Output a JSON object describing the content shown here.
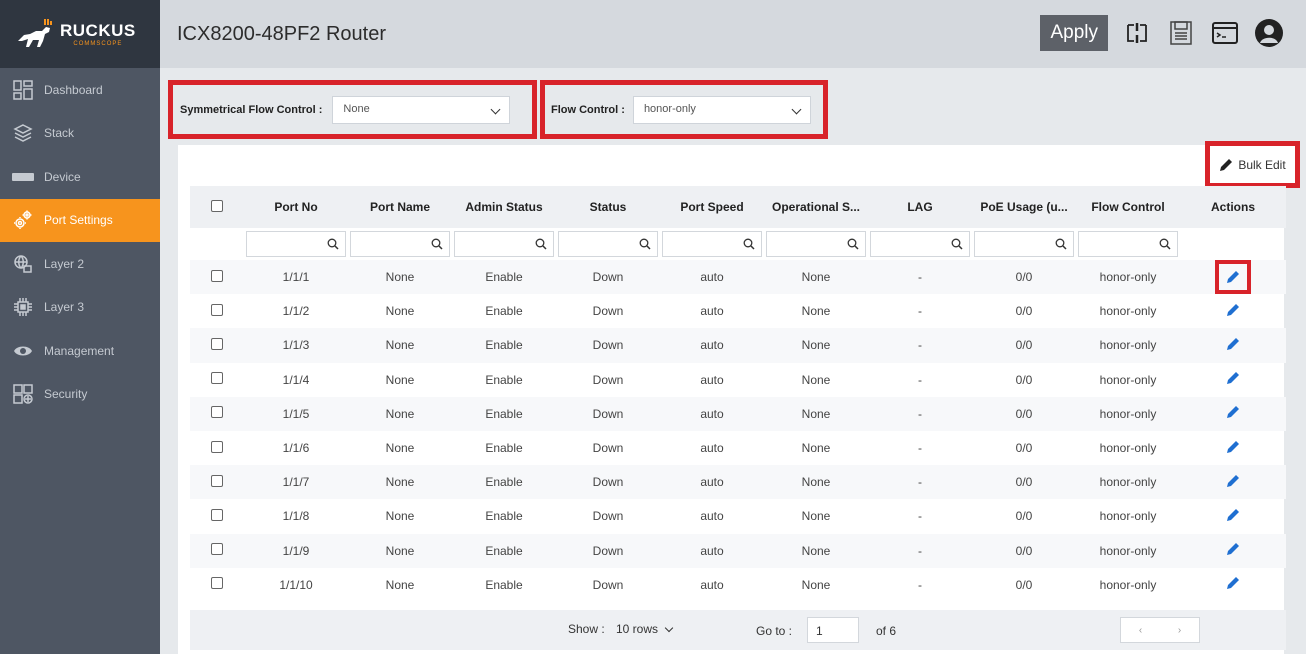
{
  "logo": {
    "brand": "RUCKUS",
    "sub": "COMMSCOPE"
  },
  "sidebar": {
    "items": [
      {
        "label": "Dashboard",
        "icon": "dashboard-icon"
      },
      {
        "label": "Stack",
        "icon": "stack-icon"
      },
      {
        "label": "Device",
        "icon": "device-icon"
      },
      {
        "label": "Port Settings",
        "icon": "gears-icon",
        "active": true
      },
      {
        "label": "Layer 2",
        "icon": "layer2-icon"
      },
      {
        "label": "Layer 3",
        "icon": "layer3-icon"
      },
      {
        "label": "Management",
        "icon": "eye-icon"
      },
      {
        "label": "Security",
        "icon": "security-icon"
      }
    ]
  },
  "header": {
    "title": "ICX8200-48PF2 Router",
    "apply_label": "Apply"
  },
  "filters": {
    "symmetrical_label": "Symmetrical Flow Control :",
    "symmetrical_value": "None",
    "flow_label": "Flow Control :",
    "flow_value": "honor-only"
  },
  "bulk_edit_label": "Bulk Edit",
  "table": {
    "columns": [
      "Port No",
      "Port Name",
      "Admin Status",
      "Status",
      "Port Speed",
      "Operational S...",
      "LAG",
      "PoE Usage (u...",
      "Flow Control",
      "Actions"
    ],
    "rows": [
      {
        "port": "1/1/1",
        "name": "None",
        "admin": "Enable",
        "status": "Down",
        "speed": "auto",
        "oper": "None",
        "lag": "-",
        "poe": "0/0",
        "flow": "honor-only"
      },
      {
        "port": "1/1/2",
        "name": "None",
        "admin": "Enable",
        "status": "Down",
        "speed": "auto",
        "oper": "None",
        "lag": "-",
        "poe": "0/0",
        "flow": "honor-only"
      },
      {
        "port": "1/1/3",
        "name": "None",
        "admin": "Enable",
        "status": "Down",
        "speed": "auto",
        "oper": "None",
        "lag": "-",
        "poe": "0/0",
        "flow": "honor-only"
      },
      {
        "port": "1/1/4",
        "name": "None",
        "admin": "Enable",
        "status": "Down",
        "speed": "auto",
        "oper": "None",
        "lag": "-",
        "poe": "0/0",
        "flow": "honor-only"
      },
      {
        "port": "1/1/5",
        "name": "None",
        "admin": "Enable",
        "status": "Down",
        "speed": "auto",
        "oper": "None",
        "lag": "-",
        "poe": "0/0",
        "flow": "honor-only"
      },
      {
        "port": "1/1/6",
        "name": "None",
        "admin": "Enable",
        "status": "Down",
        "speed": "auto",
        "oper": "None",
        "lag": "-",
        "poe": "0/0",
        "flow": "honor-only"
      },
      {
        "port": "1/1/7",
        "name": "None",
        "admin": "Enable",
        "status": "Down",
        "speed": "auto",
        "oper": "None",
        "lag": "-",
        "poe": "0/0",
        "flow": "honor-only"
      },
      {
        "port": "1/1/8",
        "name": "None",
        "admin": "Enable",
        "status": "Down",
        "speed": "auto",
        "oper": "None",
        "lag": "-",
        "poe": "0/0",
        "flow": "honor-only"
      },
      {
        "port": "1/1/9",
        "name": "None",
        "admin": "Enable",
        "status": "Down",
        "speed": "auto",
        "oper": "None",
        "lag": "-",
        "poe": "0/0",
        "flow": "honor-only"
      },
      {
        "port": "1/1/10",
        "name": "None",
        "admin": "Enable",
        "status": "Down",
        "speed": "auto",
        "oper": "None",
        "lag": "-",
        "poe": "0/0",
        "flow": "honor-only"
      }
    ]
  },
  "footer": {
    "show_label": "Show :",
    "rows_value": "10 rows",
    "goto_label": "Go to :",
    "page_value": "1",
    "of_label": "of  6",
    "prev": "‹",
    "next": "›"
  },
  "colors": {
    "accent": "#f7941d",
    "highlight": "#d8232a",
    "edit_icon": "#1f6fd1",
    "sidebar": "#4e5663"
  }
}
